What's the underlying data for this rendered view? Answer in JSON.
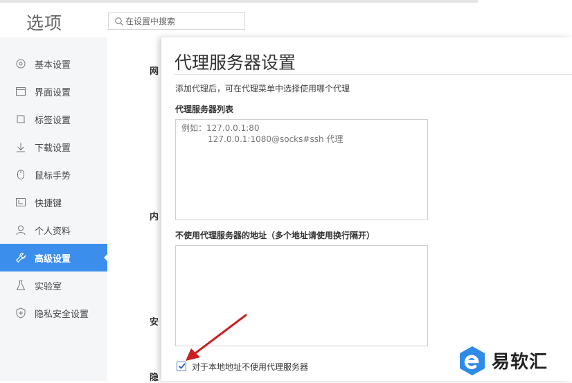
{
  "app": {
    "title": "选项"
  },
  "search": {
    "placeholder": "在设置中搜索"
  },
  "sidebar": {
    "items": [
      {
        "label": "基本设置",
        "icon": "gear-icon"
      },
      {
        "label": "界面设置",
        "icon": "window-icon"
      },
      {
        "label": "标签设置",
        "icon": "tab-icon"
      },
      {
        "label": "下载设置",
        "icon": "download-icon"
      },
      {
        "label": "鼠标手势",
        "icon": "mouse-icon"
      },
      {
        "label": "快捷键",
        "icon": "shortcut-icon"
      },
      {
        "label": "个人资料",
        "icon": "user-icon"
      },
      {
        "label": "高级设置",
        "icon": "wrench-icon",
        "active": true
      },
      {
        "label": "实验室",
        "icon": "flask-icon"
      },
      {
        "label": "隐私安全设置",
        "icon": "shield-icon"
      }
    ]
  },
  "background_labels": [
    "网",
    "内",
    "安",
    "隐"
  ],
  "dialog": {
    "title": "代理服务器设置",
    "description": "添加代理后，可在代理菜单中选择使用哪个代理",
    "proxy_list_label": "代理服务器列表",
    "proxy_list_placeholder": "例如：127.0.0.1:80\n          127.0.0.1:1080@socks#ssh 代理",
    "bypass_label": "不使用代理服务器的地址（多个地址请使用换行隔开）",
    "bypass_value": "",
    "local_bypass_label": "对于本地地址不使用代理服务器",
    "local_bypass_checked": true
  },
  "watermark": {
    "text": "易软汇",
    "color": "#2f8be8"
  },
  "colors": {
    "accent": "#3c8eec",
    "arrow": "#cc1f1f"
  }
}
